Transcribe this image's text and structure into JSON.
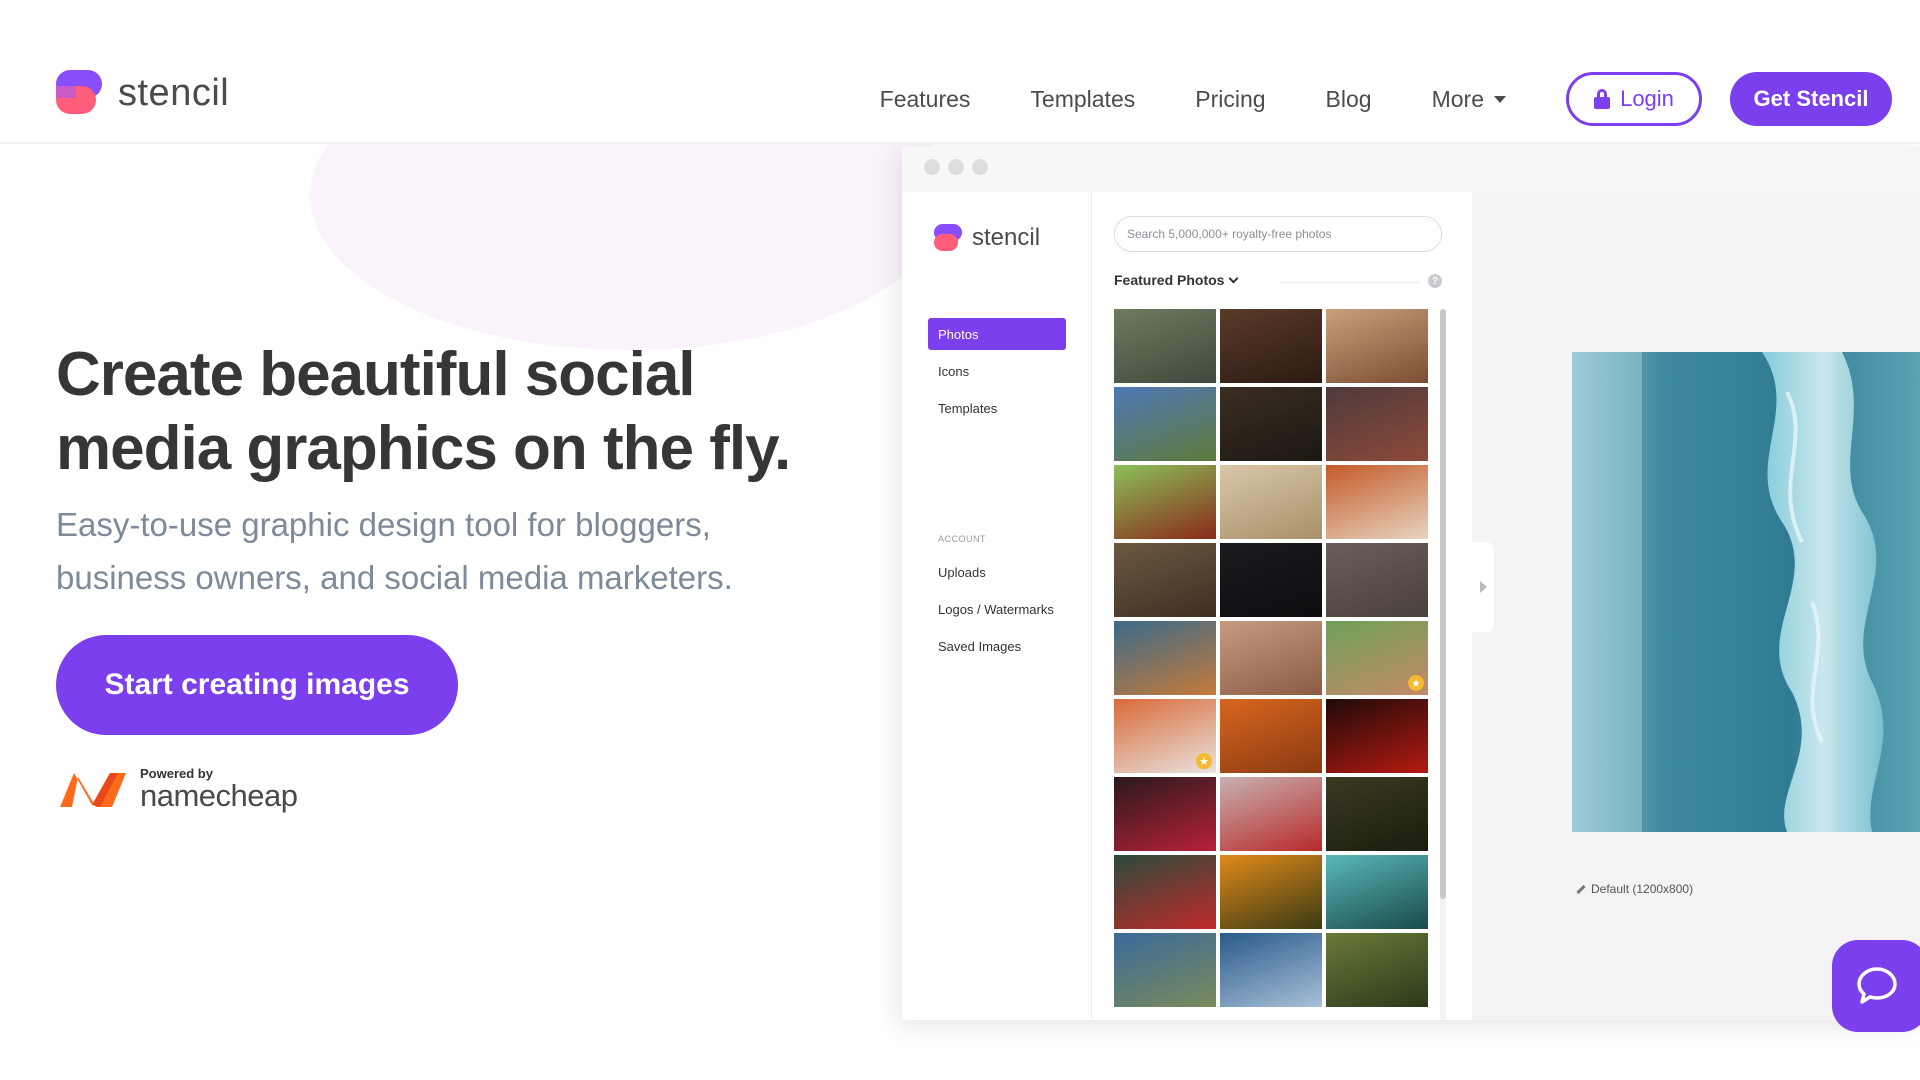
{
  "header": {
    "logo_text": "stencil",
    "nav": [
      {
        "label": "Features"
      },
      {
        "label": "Templates"
      },
      {
        "label": "Pricing"
      },
      {
        "label": "Blog"
      },
      {
        "label": "More"
      }
    ],
    "login_label": "Login",
    "get_label": "Get Stencil"
  },
  "hero": {
    "title": "Create beautiful social media graphics on the fly.",
    "subtitle": "Easy-to-use graphic design tool for bloggers, business owners, and social media marketers.",
    "cta_label": "Start creating images",
    "powered_by": "Powered by",
    "partner": "namecheap"
  },
  "app": {
    "logo_text": "stencil",
    "sidebar_main": [
      "Photos",
      "Icons",
      "Templates"
    ],
    "account_heading": "ACCOUNT",
    "sidebar_account": [
      "Uploads",
      "Logos / Watermarks",
      "Saved Images"
    ],
    "search_placeholder": "Search 5,000,000+ royalty-free photos",
    "featured_label": "Featured Photos",
    "help_symbol": "?",
    "canvas_label": "Default (1200x800)",
    "photos": [
      {
        "name": "forest-path-photo",
        "colors": [
          "#6f7a62",
          "#3e4a3b"
        ],
        "star": false
      },
      {
        "name": "baking-dough-photo",
        "colors": [
          "#5a3b2a",
          "#2b1a12"
        ],
        "star": false
      },
      {
        "name": "desk-flatlay-photo",
        "colors": [
          "#c9a07a",
          "#7b4d33"
        ],
        "star": false
      },
      {
        "name": "country-road-photo",
        "colors": [
          "#4f78b6",
          "#5e7a3a"
        ],
        "star": false
      },
      {
        "name": "dark-interior-photo",
        "colors": [
          "#3a2e22",
          "#1c1812"
        ],
        "star": false
      },
      {
        "name": "cupcakes-photo",
        "colors": [
          "#4f3a3a",
          "#8c4a3a"
        ],
        "star": false
      },
      {
        "name": "flower-box-photo",
        "colors": [
          "#8bbf5a",
          "#8a2a1a"
        ],
        "star": false
      },
      {
        "name": "bread-rolls-photo",
        "colors": [
          "#d8c7a8",
          "#a8916a"
        ],
        "star": false
      },
      {
        "name": "notebook-camera-photo",
        "colors": [
          "#c45a2a",
          "#e7d4c0"
        ],
        "star": false
      },
      {
        "name": "wood-desk-photo",
        "colors": [
          "#6b5840",
          "#3c3024"
        ],
        "star": false
      },
      {
        "name": "neon-heart-photo",
        "colors": [
          "#1a1a1f",
          "#0d0d10"
        ],
        "star": false
      },
      {
        "name": "hands-heart-photo",
        "colors": [
          "#6a5e58",
          "#4a403c"
        ],
        "star": false
      },
      {
        "name": "laptop-desk-photo",
        "colors": [
          "#3b6a8a",
          "#c57a3a"
        ],
        "star": false
      },
      {
        "name": "baby-sleeping-photo",
        "colors": [
          "#c89a80",
          "#8a5c44"
        ],
        "star": false
      },
      {
        "name": "kids-kiss-photo",
        "colors": [
          "#6fa05a",
          "#c48a6a"
        ],
        "star": true
      },
      {
        "name": "red-bag-photo",
        "colors": [
          "#d96a3a",
          "#e8e2dc"
        ],
        "star": true
      },
      {
        "name": "autumn-path-photo",
        "colors": [
          "#d8661f",
          "#8a3a12"
        ],
        "star": false
      },
      {
        "name": "candle-photo",
        "colors": [
          "#200a08",
          "#b51a12"
        ],
        "star": false
      },
      {
        "name": "red-rose-photo",
        "colors": [
          "#2a1a1a",
          "#b8203a"
        ],
        "star": false
      },
      {
        "name": "heart-tree-photo",
        "colors": [
          "#c8b0b0",
          "#b82a2a"
        ],
        "star": false
      },
      {
        "name": "forest-light-photo",
        "colors": [
          "#3a3a22",
          "#1c1c10"
        ],
        "star": false
      },
      {
        "name": "red-flowers-photo",
        "colors": [
          "#2a4a3a",
          "#c02a2a"
        ],
        "star": false
      },
      {
        "name": "orange-flowers-photo",
        "colors": [
          "#e08a1a",
          "#3a3a14"
        ],
        "star": false
      },
      {
        "name": "dandelion-photo",
        "colors": [
          "#5ab8b8",
          "#1a4a4a"
        ],
        "star": false
      },
      {
        "name": "cottage-photo",
        "colors": [
          "#3a6a9a",
          "#7a8a5a"
        ],
        "star": false
      },
      {
        "name": "lake-mountains-photo",
        "colors": [
          "#2a5a8a",
          "#a8c0d8"
        ],
        "star": false
      },
      {
        "name": "tree-canopy-photo",
        "colors": [
          "#6a7a3a",
          "#2a3a1a"
        ],
        "star": false
      }
    ]
  },
  "colors": {
    "brand_purple": "#7b3fee",
    "brand_pink": "#ff5d7a"
  },
  "icons": {
    "chat": "chat-bubble-icon",
    "lock": "lock-icon"
  }
}
